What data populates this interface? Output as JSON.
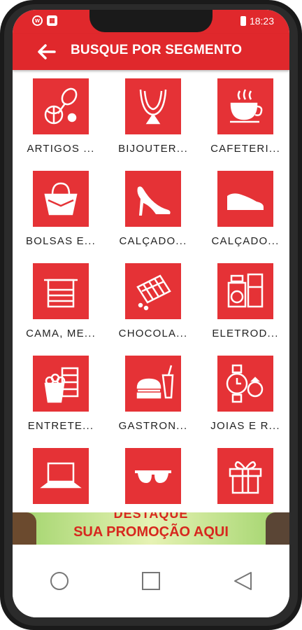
{
  "status_bar": {
    "time": "18:23",
    "left_icons": [
      "whatsapp-icon",
      "gallery-icon"
    ]
  },
  "header": {
    "title": "BUSQUE POR SEGMENTO",
    "back_icon": "arrow-left-icon"
  },
  "colors": {
    "primary": "#e0282c",
    "tile": "#e53236"
  },
  "segments": [
    {
      "label": "ARTIGOS ...",
      "icon": "sports-icon"
    },
    {
      "label": "BIJOUTER...",
      "icon": "necklace-icon"
    },
    {
      "label": "CAFETERI...",
      "icon": "coffee-cup-icon"
    },
    {
      "label": "BOLSAS E...",
      "icon": "handbag-icon"
    },
    {
      "label": "CALÇADO...",
      "icon": "high-heel-icon"
    },
    {
      "label": "CALÇADO...",
      "icon": "shoe-icon"
    },
    {
      "label": "CAMA, ME...",
      "icon": "towel-icon"
    },
    {
      "label": "CHOCOLA...",
      "icon": "chocolate-icon"
    },
    {
      "label": "ELETROD...",
      "icon": "appliances-icon"
    },
    {
      "label": "ENTRETE...",
      "icon": "popcorn-icon"
    },
    {
      "label": "GASTRON...",
      "icon": "burger-icon"
    },
    {
      "label": "JOIAS E R...",
      "icon": "watch-ring-icon"
    },
    {
      "label": "",
      "icon": "laptop-icon"
    },
    {
      "label": "",
      "icon": "sunglasses-icon"
    },
    {
      "label": "",
      "icon": "gift-icon"
    }
  ],
  "banner": {
    "line1": "DESTAQUE",
    "line2": "SUA PROMOÇÃO AQUI"
  },
  "nav": {
    "icons": [
      "home-circle-icon",
      "recent-apps-icon",
      "back-triangle-icon"
    ]
  }
}
